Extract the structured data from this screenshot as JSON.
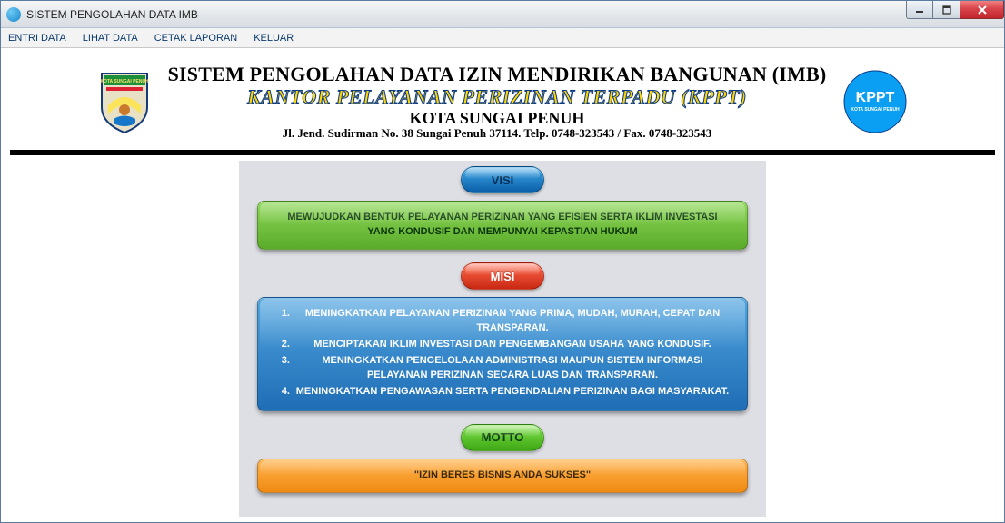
{
  "window": {
    "title": "SISTEM PENGOLAHAN DATA IMB"
  },
  "menu": {
    "entri": "ENTRI DATA",
    "lihat": "LIHAT DATA",
    "cetak": "CETAK LAPORAN",
    "keluar": "KELUAR"
  },
  "header": {
    "line1": "SISTEM PENGOLAHAN DATA IZIN MENDIRIKAN BANGUNAN (IMB)",
    "line2": "KANTOR PELAYANAN PERIZINAN TERPADU (KPPT)",
    "line3": "KOTA SUNGAI PENUH",
    "line4": "Jl. Jend. Sudirman No. 38 Sungai Penuh 37114. Telp. 0748-323543 / Fax. 0748-323543",
    "logo_text_main": "KPPT",
    "logo_text_sub": "KOTA SUNGAI PENUH"
  },
  "sections": {
    "visi": {
      "label": "VISI",
      "text": "MEWUJUDKAN BENTUK PELAYANAN PERIZINAN YANG EFISIEN SERTA IKLIM INVESTASI YANG KONDUSIF DAN MEMPUNYAI KEPASTIAN HUKUM"
    },
    "misi": {
      "label": "MISI",
      "items": [
        "MENINGKATKAN PELAYANAN PERIZINAN YANG PRIMA, MUDAH, MURAH, CEPAT DAN TRANSPARAN.",
        "MENCIPTAKAN IKLIM INVESTASI DAN PENGEMBANGAN USAHA YANG KONDUSIF.",
        "MENINGKATKAN PENGELOLAAN ADMINISTRASI MAUPUN SISTEM INFORMASI PELAYANAN PERIZINAN SECARA LUAS DAN TRANSPARAN.",
        "MENINGKATKAN PENGAWASAN SERTA PENGENDALIAN PERIZINAN BAGI MASYARAKAT."
      ]
    },
    "motto": {
      "label": "MOTTO",
      "text": "\"IZIN BERES BISNIS ANDA SUKSES\""
    }
  }
}
